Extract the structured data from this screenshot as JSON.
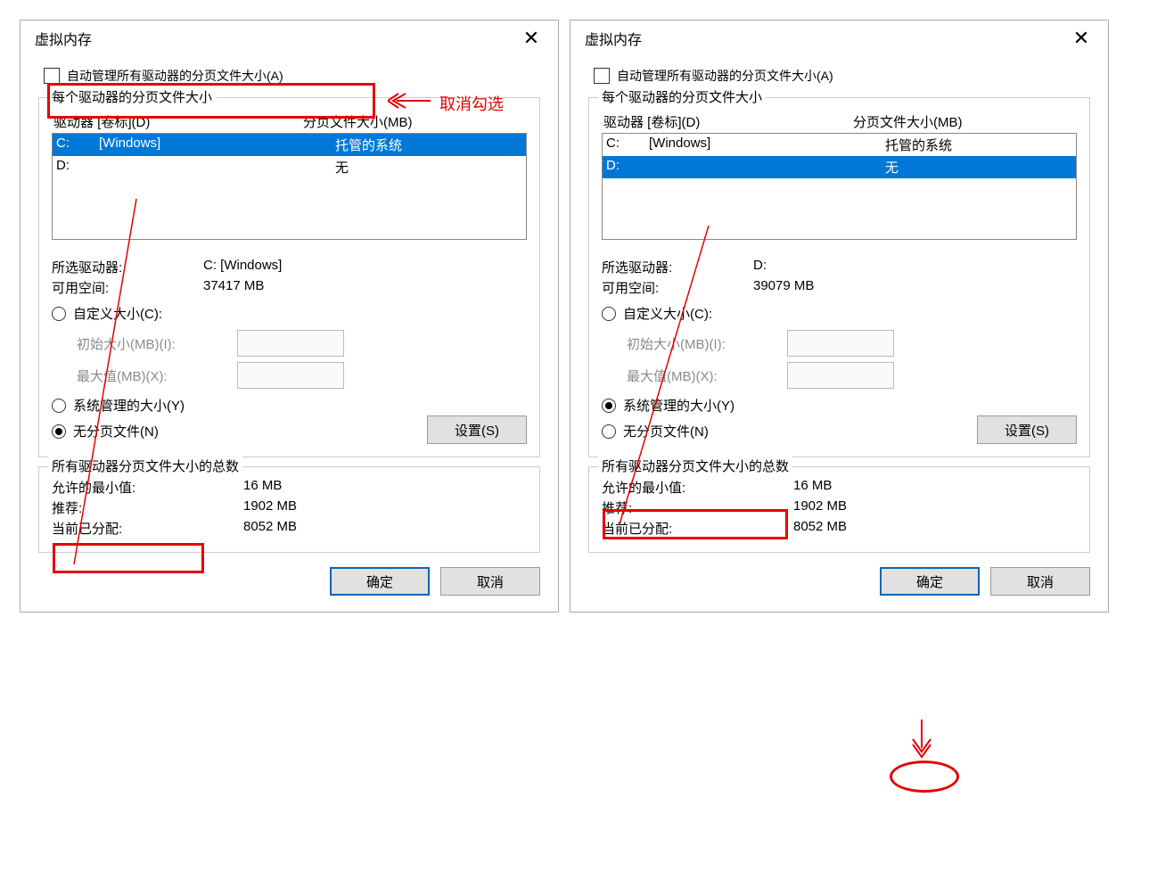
{
  "annotations": {
    "uncheck_text": "取消勾选"
  },
  "left": {
    "title": "虚拟内存",
    "auto_manage_label": "自动管理所有驱动器的分页文件大小(A)",
    "group1_legend": "每个驱动器的分页文件大小",
    "col_drive": "驱动器 [卷标](D)",
    "col_size": "分页文件大小(MB)",
    "drives": [
      {
        "d": "C:",
        "label": "[Windows]",
        "size": "托管的系统",
        "selected": true
      },
      {
        "d": "D:",
        "label": "",
        "size": "无",
        "selected": false
      }
    ],
    "selected_drive_label": "所选驱动器:",
    "selected_drive_value": "C:  [Windows]",
    "free_space_label": "可用空间:",
    "free_space_value": "37417 MB",
    "radio_custom": "自定义大小(C):",
    "initial_label": "初始大小(MB)(I):",
    "max_label": "最大值(MB)(X):",
    "radio_system": "系统管理的大小(Y)",
    "radio_none": "无分页文件(N)",
    "radio_selected": "none",
    "set_button": "设置(S)",
    "group2_legend": "所有驱动器分页文件大小的总数",
    "min_label": "允许的最小值:",
    "min_value": "16 MB",
    "rec_label": "推荐:",
    "rec_value": "1902 MB",
    "cur_label": "当前已分配:",
    "cur_value": "8052 MB",
    "ok": "确定",
    "cancel": "取消"
  },
  "right": {
    "title": "虚拟内存",
    "auto_manage_label": "自动管理所有驱动器的分页文件大小(A)",
    "group1_legend": "每个驱动器的分页文件大小",
    "col_drive": "驱动器 [卷标](D)",
    "col_size": "分页文件大小(MB)",
    "drives": [
      {
        "d": "C:",
        "label": "[Windows]",
        "size": "托管的系统",
        "selected": false
      },
      {
        "d": "D:",
        "label": "",
        "size": "无",
        "selected": true
      }
    ],
    "selected_drive_label": "所选驱动器:",
    "selected_drive_value": "D:",
    "free_space_label": "可用空间:",
    "free_space_value": "39079 MB",
    "radio_custom": "自定义大小(C):",
    "initial_label": "初始大小(MB)(I):",
    "max_label": "最大值(MB)(X):",
    "radio_system": "系统管理的大小(Y)",
    "radio_none": "无分页文件(N)",
    "radio_selected": "system",
    "set_button": "设置(S)",
    "group2_legend": "所有驱动器分页文件大小的总数",
    "min_label": "允许的最小值:",
    "min_value": "16 MB",
    "rec_label": "推荐:",
    "rec_value": "1902 MB",
    "cur_label": "当前已分配:",
    "cur_value": "8052 MB",
    "ok": "确定",
    "cancel": "取消"
  }
}
